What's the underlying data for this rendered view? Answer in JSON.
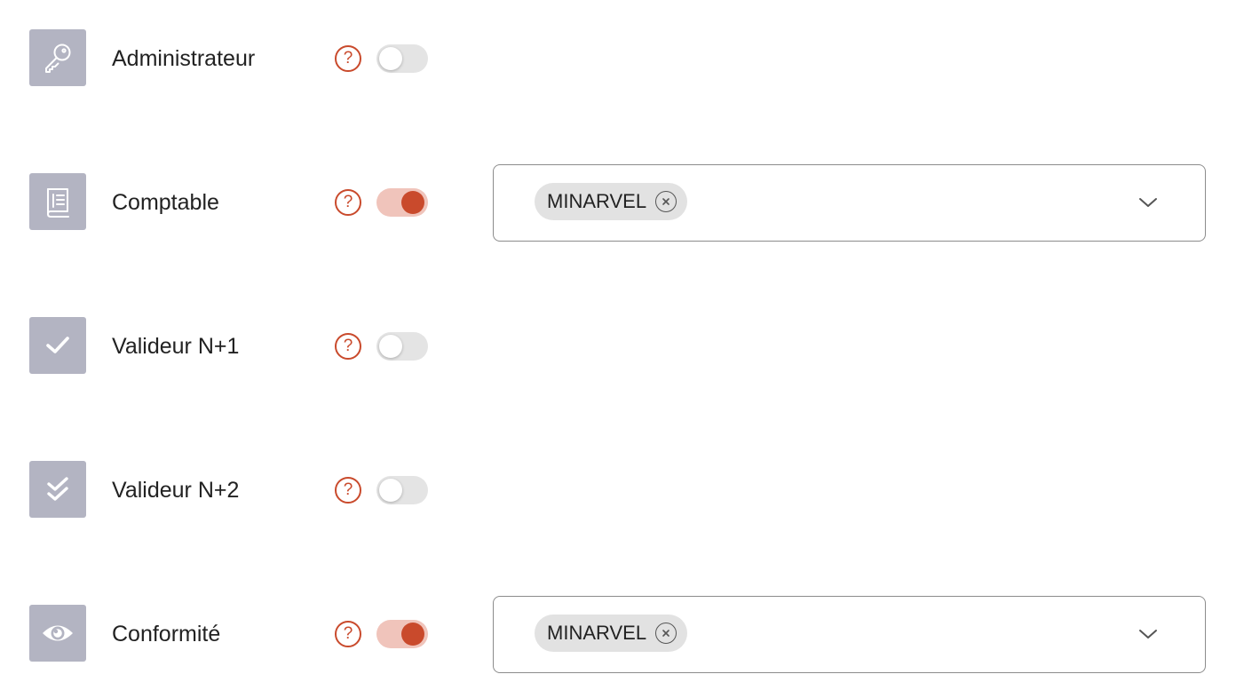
{
  "colors": {
    "icon_tile": "#b3b4c2",
    "accent": "#c94a2c",
    "toggle_on_track": "#f0c4bb",
    "toggle_on_knob": "#c94a2c",
    "toggle_off_track": "#e4e4e4"
  },
  "help_glyph": "?",
  "roles": [
    {
      "label": "Administrateur",
      "icon": "key-icon",
      "enabled": false,
      "selected": []
    },
    {
      "label": "Comptable",
      "icon": "ledger-book-icon",
      "enabled": true,
      "selected": [
        "MINARVEL"
      ]
    },
    {
      "label": "Valideur N+1",
      "icon": "check-icon",
      "enabled": false,
      "selected": []
    },
    {
      "label": "Valideur N+2",
      "icon": "double-check-icon",
      "enabled": false,
      "selected": []
    },
    {
      "label": "Conformité",
      "icon": "eye-icon",
      "enabled": true,
      "selected": [
        "MINARVEL"
      ]
    }
  ]
}
